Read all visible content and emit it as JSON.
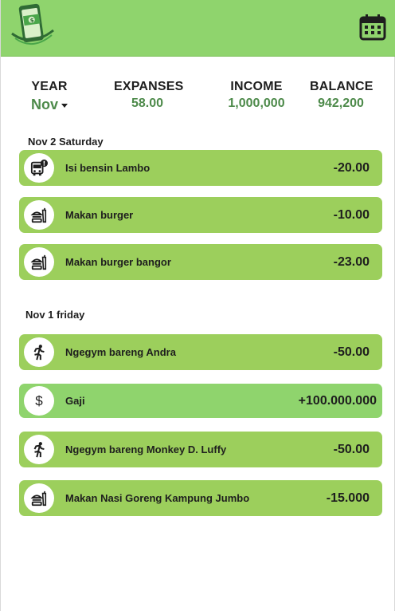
{
  "header": {
    "logo_icon": "wallet-phone-logo",
    "calendar_icon": "calendar-icon",
    "accent": "#8fd46d"
  },
  "summary": {
    "year_label": "YEAR",
    "month_value": "Nov",
    "expenses_label": "EXPANSES",
    "expenses_value": "58.00",
    "income_label": "INCOME",
    "income_value": "1,000,000",
    "balance_label": "BALANCE",
    "balance_value": "942,200"
  },
  "groups": [
    {
      "date": "Nov 2 Saturday",
      "items": [
        {
          "icon": "car-warning-icon",
          "label": "Isi bensin Lambo",
          "amount": "-20.00"
        },
        {
          "icon": "burger-icon",
          "label": "Makan burger",
          "amount": "-10.00"
        },
        {
          "icon": "burger-icon",
          "label": "Makan burger bangor",
          "amount": "-23.00"
        }
      ]
    },
    {
      "date": "Nov 1 friday",
      "items": [
        {
          "icon": "running-icon",
          "label": "Ngegym bareng Andra",
          "amount": "-50.00"
        },
        {
          "icon": "dollar-icon",
          "label": "Gaji",
          "amount": "+100.000.000"
        },
        {
          "icon": "running-icon",
          "label": "Ngegym bareng Monkey D. Luffy",
          "amount": "-50.00"
        },
        {
          "icon": "burger-icon",
          "label": "Makan Nasi Goreng Kampung Jumbo",
          "amount": "-15.000"
        }
      ]
    }
  ]
}
